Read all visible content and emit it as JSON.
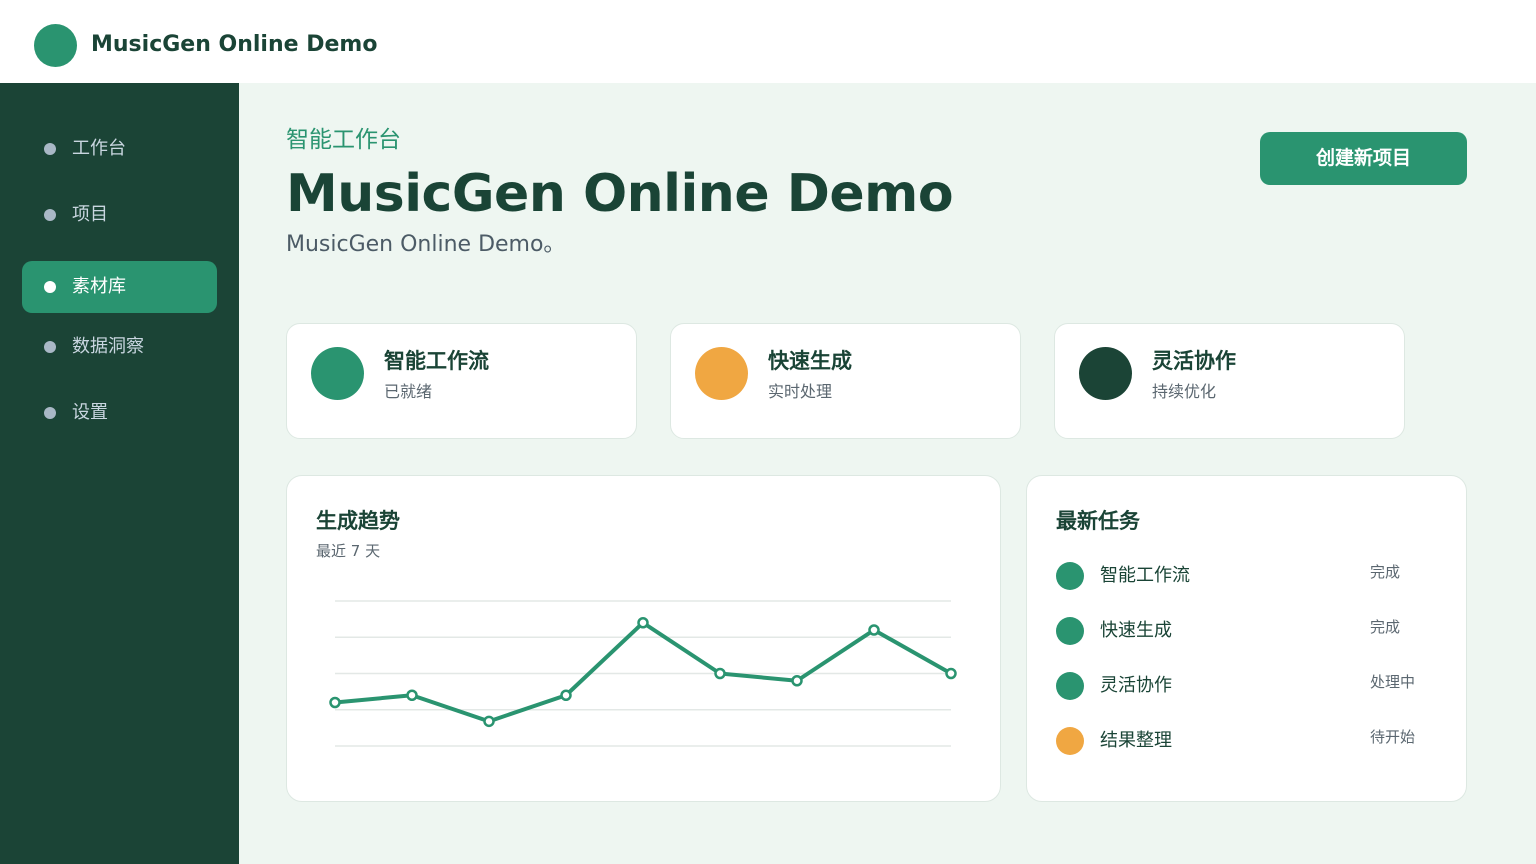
{
  "app": {
    "title": "MusicGen Online Demo"
  },
  "sidebar": {
    "items": [
      {
        "label": "工作台",
        "active": false
      },
      {
        "label": "项目",
        "active": false
      },
      {
        "label": "素材库",
        "active": true
      },
      {
        "label": "数据洞察",
        "active": false
      },
      {
        "label": "设置",
        "active": false
      }
    ]
  },
  "header": {
    "kicker": "智能工作台",
    "title": "MusicGen Online Demo",
    "subtitle": "MusicGen Online Demo。",
    "create_button": "创建新项目"
  },
  "cards": [
    {
      "title": "智能工作流",
      "subtitle": "已就绪",
      "color": "#2a9470"
    },
    {
      "title": "快速生成",
      "subtitle": "实时处理",
      "color": "#f0a742"
    },
    {
      "title": "灵活协作",
      "subtitle": "持续优化",
      "color": "#1b4436"
    }
  ],
  "trend": {
    "title": "生成趋势",
    "subtitle": "最近 7 天"
  },
  "chart_data": {
    "type": "line",
    "title": "生成趋势",
    "xlabel": "",
    "ylabel": "",
    "ylim": [
      0,
      100
    ],
    "grid": true,
    "series": [
      {
        "values": [
          30,
          35,
          17,
          35,
          85,
          50,
          45,
          80,
          50
        ],
        "color": "#2a9470"
      }
    ]
  },
  "tasks": {
    "title": "最新任务",
    "items": [
      {
        "name": "智能工作流",
        "status": "完成",
        "color": "#2a9470"
      },
      {
        "name": "快速生成",
        "status": "完成",
        "color": "#2a9470"
      },
      {
        "name": "灵活协作",
        "status": "处理中",
        "color": "#2a9470"
      },
      {
        "name": "结果整理",
        "status": "待开始",
        "color": "#f0a742"
      }
    ]
  },
  "colors": {
    "brand": "#2a9470",
    "sidebar": "#1b4436",
    "accent": "#f0a742",
    "background": "#eef6f1"
  }
}
